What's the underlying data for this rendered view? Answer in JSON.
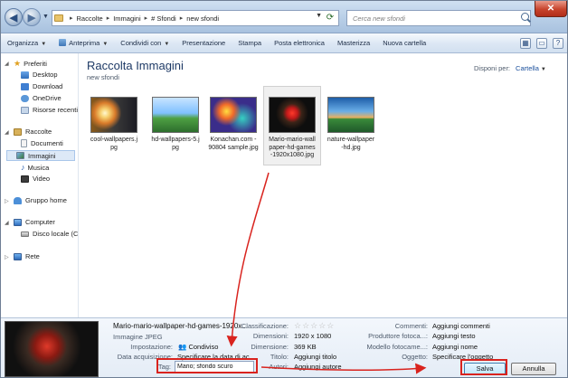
{
  "address": {
    "crumbs": [
      "Raccolte",
      "Immagini",
      "# Sfondi",
      "new sfondi"
    ]
  },
  "search": {
    "placeholder": "Cerca new sfondi"
  },
  "toolbar": {
    "items": [
      "Organizza",
      "Anteprima",
      "Condividi con",
      "Presentazione",
      "Stampa",
      "Posta elettronica",
      "Masterizza",
      "Nuova cartella"
    ]
  },
  "sidebar": {
    "favorites": {
      "label": "Preferiti",
      "items": [
        "Desktop",
        "Download",
        "OneDrive",
        "Risorse recenti"
      ]
    },
    "libraries": {
      "label": "Raccolte",
      "items": [
        "Documenti",
        "Immagini",
        "Musica",
        "Video"
      ]
    },
    "homegroup": "Gruppo home",
    "computer": {
      "label": "Computer",
      "items": [
        "Disco locale (C:"
      ]
    },
    "network": "Rete"
  },
  "main": {
    "title": "Raccolta Immagini",
    "subtitle": "new sfondi",
    "arrange_label": "Disponi per:",
    "arrange_value": "Cartella",
    "files": [
      {
        "lines": [
          "cool-wallpapers.j",
          "pg"
        ]
      },
      {
        "lines": [
          "hd-wallpapers-5.j",
          "pg"
        ]
      },
      {
        "lines": [
          "Konachan.com -",
          "90804 sample.jpg"
        ]
      },
      {
        "lines": [
          "Mario-mario-wall",
          "paper-hd-games",
          "-1920x1080.jpg"
        ]
      },
      {
        "lines": [
          "nature-wallpaper",
          "-hd.jpg"
        ]
      }
    ]
  },
  "details": {
    "name": "Mario-mario-wallpaper-hd-games-1920x...",
    "type": "Immagine JPEG",
    "fields": {
      "impostazione_label": "Impostazione:",
      "impostazione_value": "Condiviso",
      "data_label": "Data acquisizione:",
      "data_value": "Specificare la data di ac...",
      "tag_label": "Tag:",
      "tag_value": "Mario; sfondo scuro",
      "classificazione_label": "Classificazione:",
      "stars": "☆☆☆☆☆",
      "dimensioni_label": "Dimensioni:",
      "dimensioni_value": "1920 x 1080",
      "dimensione_label": "Dimensione:",
      "dimensione_value": "369 KB",
      "titolo_label": "Titolo:",
      "titolo_value": "Aggiungi titolo",
      "autori_label": "Autori:",
      "autori_value": "Aggiungi autore",
      "commenti_label": "Commenti:",
      "commenti_value": "Aggiungi commenti",
      "produttore_label": "Produttore fotoca...:",
      "produttore_value": "Aggiungi testo",
      "modello_label": "Modello fotocame...:",
      "modello_value": "Aggiungi nome",
      "oggetto_label": "Oggetto:",
      "oggetto_value": "Specificare l'oggetto"
    },
    "save_label": "Salva",
    "cancel_label": "Annulla"
  },
  "colors": {
    "annotation": "#d9231e",
    "accent": "#1a4f9c"
  }
}
